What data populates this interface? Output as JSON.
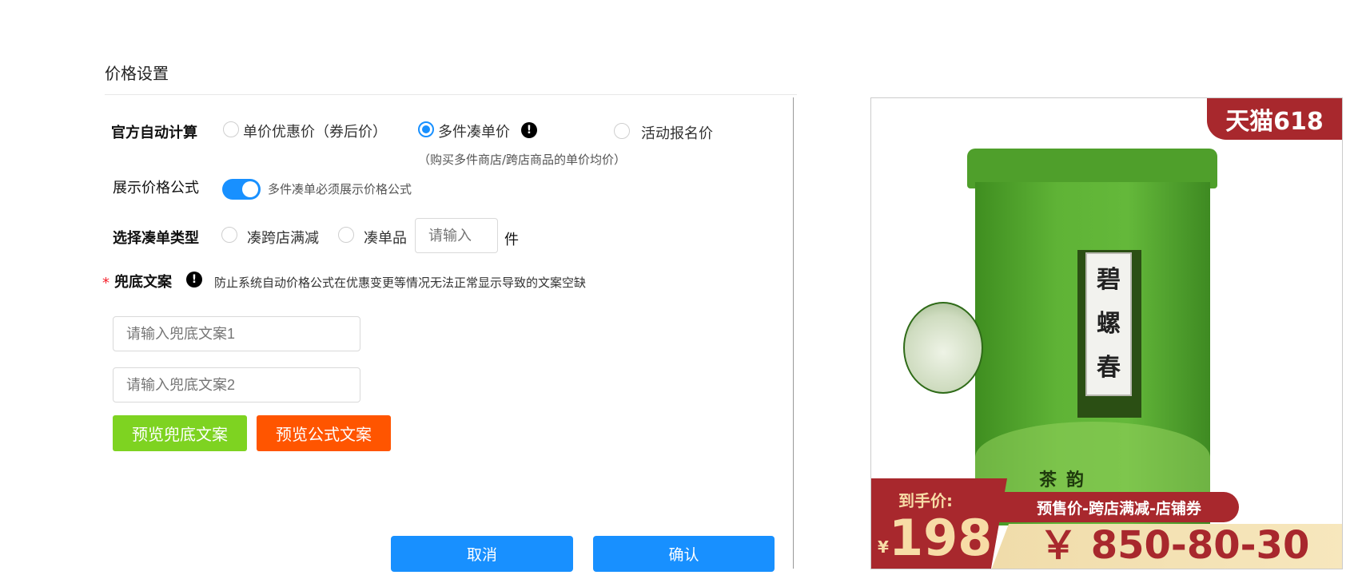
{
  "section": {
    "title": "价格设置"
  },
  "auto_calc": {
    "label": "官方自动计算",
    "options": [
      {
        "label": "单价优惠价（券后价）",
        "checked": false
      },
      {
        "label": "多件凑单价",
        "checked": true
      },
      {
        "label": "活动报名价",
        "checked": false
      }
    ],
    "info_icon": "info-icon",
    "hint": "（购买多件商店/跨店商品的单价均价）"
  },
  "show_formula": {
    "label": "展示价格公式",
    "enabled": true,
    "hint": "多件凑单必须展示价格公式"
  },
  "combo_type": {
    "label": "选择凑单类型",
    "options": [
      {
        "label": "凑跨店满减",
        "checked": false
      },
      {
        "label": "凑单品",
        "checked": false
      }
    ],
    "qty_placeholder": "请输入",
    "unit": "件"
  },
  "fallback": {
    "required_mark": "*",
    "label": "兜底文案",
    "hint": "防止系统自动价格公式在优惠变更等情况无法正常显示导致的文案空缺",
    "input1_placeholder": "请输入兜底文案1",
    "input2_placeholder": "请输入兜底文案2"
  },
  "buttons": {
    "preview_fallback": "预览兜底文案",
    "preview_formula": "预览公式文案",
    "cancel": "取消",
    "confirm": "确认"
  },
  "preview": {
    "tag": "天猫618",
    "can_label": [
      "碧",
      "螺",
      "春"
    ],
    "can_brand": "茶韵",
    "price_label": "到手价:",
    "currency": "¥",
    "price": "198",
    "formula_label": "预售价-跨店满减-店铺券",
    "formula_value": "￥ 850-80-30"
  },
  "colors": {
    "primary": "#1890ff",
    "green_button": "#7ed321",
    "orange_button": "#ff5500",
    "tmall_red": "#a8282d",
    "gold": "#f7dca6",
    "required": "#f5222d"
  }
}
